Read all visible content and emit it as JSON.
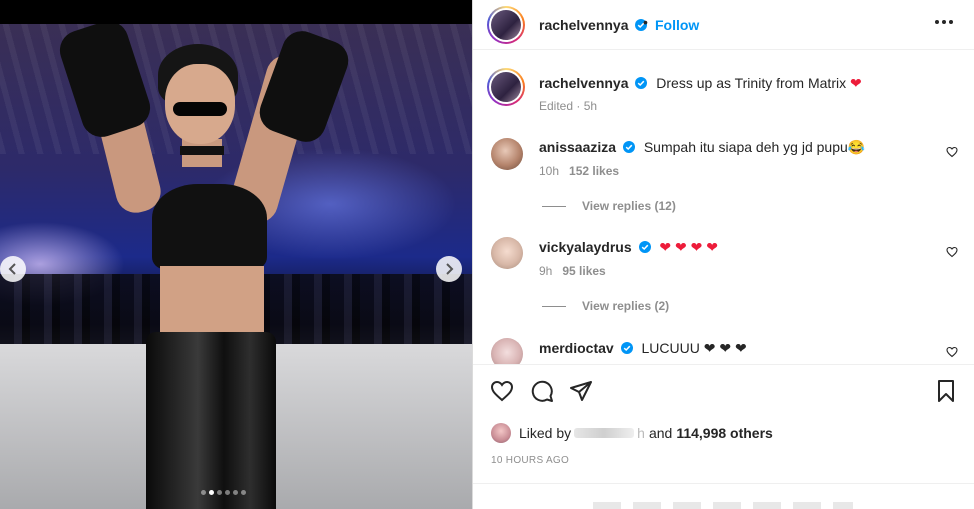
{
  "post": {
    "username": "rachelvennya",
    "follow_label": "Follow",
    "separator": "•",
    "caption": "Dress up as Trinity from Matrix",
    "caption_emoji": "❤",
    "caption_meta": "Edited · 5h"
  },
  "comments": [
    {
      "username": "anissaaziza",
      "text": "Sumpah itu siapa deh yg jd pupu😂",
      "time": "10h",
      "likes": "152 likes",
      "view_replies": "View replies (12)"
    },
    {
      "username": "vickyalaydrus",
      "text": "❤ ❤ ❤ ❤",
      "time": "9h",
      "likes": "95 likes",
      "view_replies": "View replies (2)"
    },
    {
      "username": "merdioctav",
      "text": "LUCUUU ❤ ❤ ❤"
    }
  ],
  "likes": {
    "prefix": "Liked by",
    "partial_name": "h",
    "connector": "and",
    "others": "114,998 others"
  },
  "timestamp": "10 HOURS AGO",
  "carousel": {
    "dot_count": 6,
    "active_index": 1
  },
  "colors": {
    "follow_blue": "#0095f6",
    "verified_blue": "#0095f6",
    "heart_red": "#ed1c3a",
    "meta_gray": "#8e8e8e"
  },
  "icons": [
    "verified-badge-icon",
    "more-options-icon",
    "heart-icon",
    "comment-icon",
    "share-icon",
    "bookmark-icon",
    "chevron-left-icon",
    "chevron-right-icon"
  ]
}
